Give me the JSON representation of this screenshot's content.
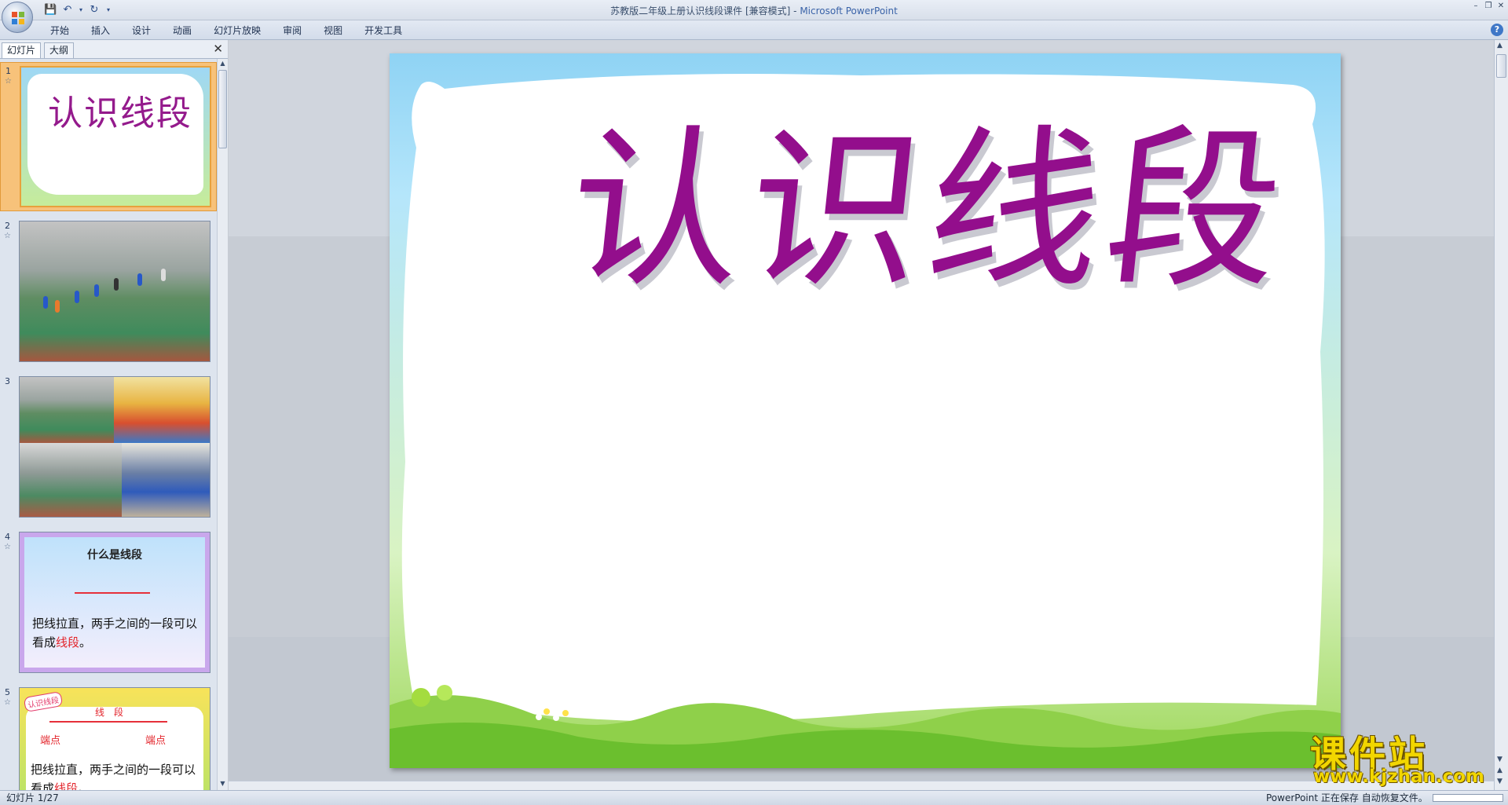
{
  "window": {
    "title": "苏教版二年级上册认识线段课件 [兼容模式] - ",
    "app_name": "Microsoft PowerPoint"
  },
  "ribbon": {
    "tabs": [
      "开始",
      "插入",
      "设计",
      "动画",
      "幻灯片放映",
      "审阅",
      "视图",
      "开发工具"
    ]
  },
  "left_pane": {
    "tabs": [
      "幻灯片",
      "大纲"
    ],
    "active_tab": "幻灯片",
    "slides": [
      {
        "number": "1",
        "title": "认识线段"
      },
      {
        "number": "2"
      },
      {
        "number": "3"
      },
      {
        "number": "4",
        "title": "什么是线段",
        "text_before": "把线拉直，两手之间的一段可以看成",
        "text_highlight": "线段",
        "text_after": "。"
      },
      {
        "number": "5",
        "tag": "认识线段",
        "segment_label": "线　段",
        "endpoint_left": "端点",
        "endpoint_right": "端点",
        "text_before": "把线拉直，两手之间的一段可以看成",
        "text_highlight": "线段",
        "text_after": "。"
      }
    ]
  },
  "slide": {
    "title": "认识线段",
    "title_color": "#930e8c"
  },
  "status_bar": {
    "slide_indicator": "幻灯片 1/27",
    "autosave_message": "PowerPoint 正在保存 自动恢复文件。"
  },
  "watermark": {
    "brand": "课件站",
    "url": "www.kjzhan.com"
  },
  "colors": {
    "accent": "#930e8c",
    "selection": "#f7c27a",
    "highlight_red": "#e3242b"
  }
}
